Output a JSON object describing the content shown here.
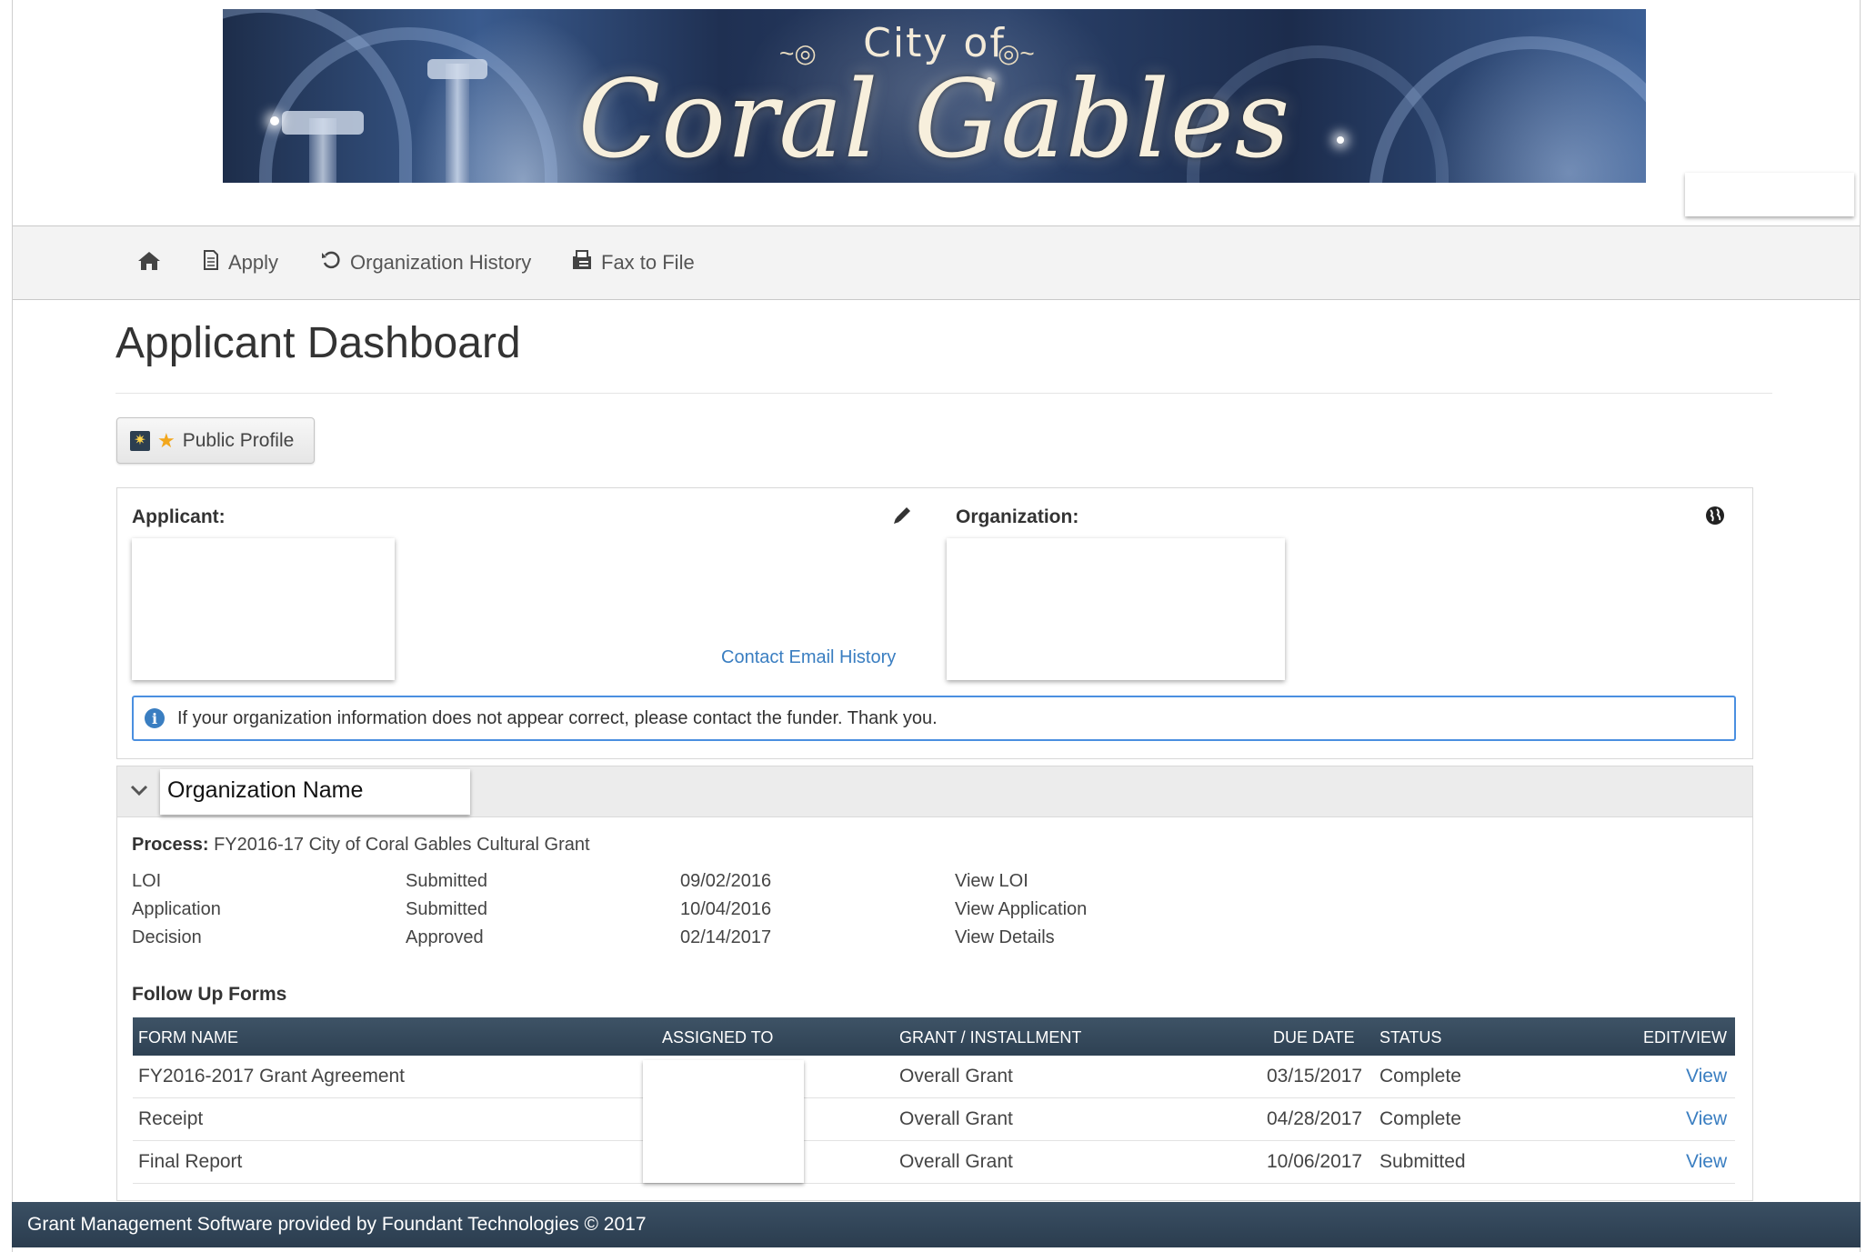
{
  "banner": {
    "title_small": "City of",
    "title_big": "Coral Gables"
  },
  "nav": {
    "home_icon": "home-icon",
    "items": [
      {
        "label": "Apply",
        "icon": "document-icon"
      },
      {
        "label": "Organization History",
        "icon": "history-icon"
      },
      {
        "label": "Fax to File",
        "icon": "fax-icon"
      }
    ]
  },
  "page": {
    "title": "Applicant Dashboard",
    "public_profile_label": "Public Profile"
  },
  "applicant_panel": {
    "applicant_label": "Applicant:",
    "organization_label": "Organization:",
    "contact_email_history": "Contact Email History",
    "alert_text": "If your organization information does not appear correct, please contact the funder. Thank you."
  },
  "organization": {
    "name": "Organization Name",
    "process_label": "Process:",
    "process_name": "FY2016-17 City of Coral Gables Cultural Grant",
    "stages": [
      {
        "stage": "LOI",
        "status": "Submitted",
        "date": "09/02/2016",
        "link": "View LOI"
      },
      {
        "stage": "Application",
        "status": "Submitted",
        "date": "10/04/2016",
        "link": "View Application"
      },
      {
        "stage": "Decision",
        "status": "Approved",
        "date": "02/14/2017",
        "link": "View Details"
      }
    ],
    "follow_up_title": "Follow Up Forms",
    "table": {
      "headers": [
        "FORM NAME",
        "ASSIGNED TO",
        "GRANT / INSTALLMENT",
        "DUE DATE",
        "STATUS",
        "EDIT/VIEW"
      ],
      "rows": [
        {
          "form": "FY2016-2017 Grant Agreement",
          "grant": "Overall Grant",
          "due": "03/15/2017",
          "status": "Complete",
          "action": "View"
        },
        {
          "form": "Receipt",
          "grant": "Overall Grant",
          "due": "04/28/2017",
          "status": "Complete",
          "action": "View"
        },
        {
          "form": "Final Report",
          "grant": "Overall Grant",
          "due": "10/06/2017",
          "status": "Submitted",
          "action": "View"
        }
      ]
    }
  },
  "footer": {
    "text": "Grant Management Software provided by Foundant Technologies © 2017"
  },
  "colors": {
    "link": "#3a7ec1",
    "table_header": "#344859",
    "footer": "#33475a",
    "alert_border": "#4a8fe0"
  }
}
